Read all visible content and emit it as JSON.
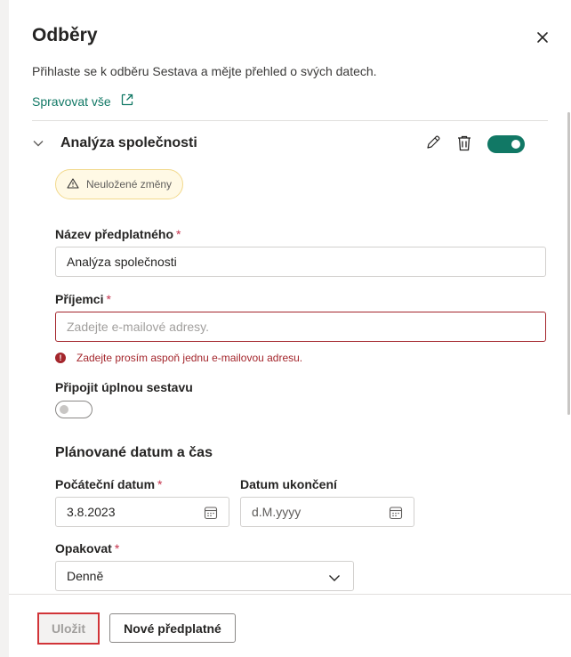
{
  "panel": {
    "title": "Odběry",
    "subtitle": "Přihlaste se k odběru Sestava a mějte přehled o svých datech.",
    "manage_all": "Spravovat vše"
  },
  "subscription": {
    "name": "Analýza společnosti",
    "enabled": true,
    "unsaved_badge": "Neuložené změny"
  },
  "form": {
    "name_label": "Název předplatného",
    "name_value": "Analýza společnosti",
    "recipients_label": "Příjemci",
    "recipients_placeholder": "Zadejte e-mailové adresy.",
    "recipients_error": "Zadejte prosím aspoň jednu e-mailovou adresu.",
    "attach_label": "Připojit úplnou sestavu",
    "attach_enabled": false,
    "required_mark": "*",
    "schedule_title": "Plánované datum a čas",
    "start_label": "Počáteční datum",
    "start_value": "3.8.2023",
    "end_label": "Datum ukončení",
    "end_placeholder": "d.M.yyyy",
    "repeat_label": "Opakovat",
    "repeat_value": "Denně"
  },
  "footer": {
    "save_label": "Uložit",
    "new_label": "Nové předplatné"
  },
  "colors": {
    "accent": "#117865",
    "error": "#a4262c",
    "highlight": "#d13438"
  }
}
